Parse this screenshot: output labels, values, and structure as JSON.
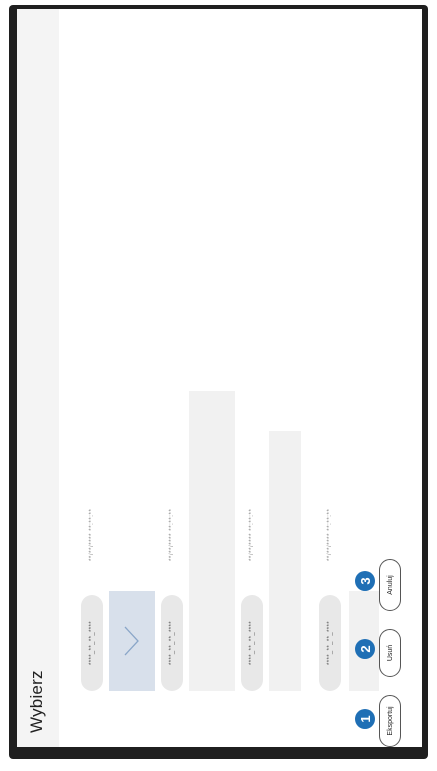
{
  "header": {
    "title": "Wybierz"
  },
  "files": [
    {
      "name": "****_**_**_****",
      "date": "**/**/**** **:**:**",
      "selected": true
    },
    {
      "name": "****_**_**_****",
      "date": "**/**/**** **:**:**",
      "selected": false
    },
    {
      "name": "****_**_**_****",
      "date": "**/**/**** **:**:**",
      "selected": false
    },
    {
      "name": "****_**_**_****",
      "date": "**/**/**** **:**:**",
      "selected": false
    }
  ],
  "actions": {
    "export_label": "Eksportuj",
    "delete_label": "Usuń",
    "cancel_label": "Anuluj"
  },
  "callouts": {
    "one": "1",
    "two": "2",
    "three": "3"
  },
  "colors": {
    "accent": "#1f6fb5",
    "selected_thumb": "#d8e0eb",
    "frame": "#1f1f1f"
  }
}
